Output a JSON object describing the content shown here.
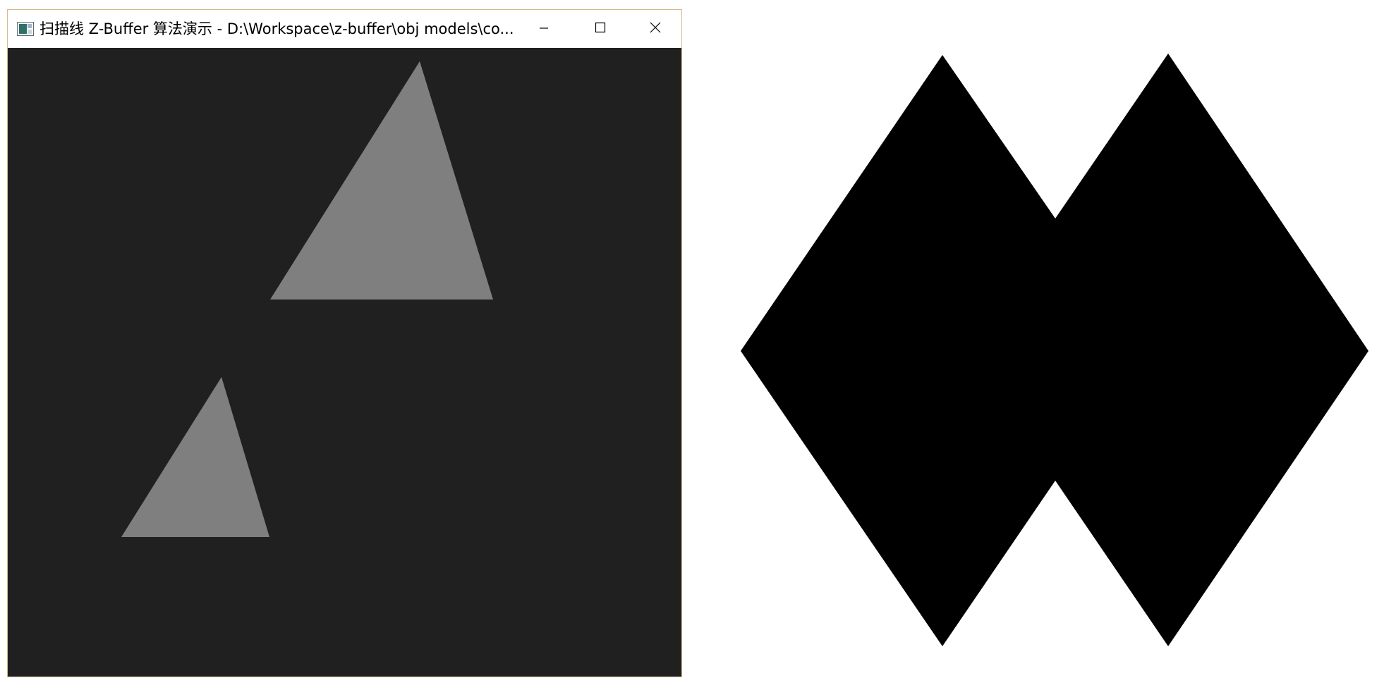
{
  "window": {
    "title": "扫描线 Z-Buffer 算法演示 - D:\\Workspace\\z-buffer\\obj models\\co...",
    "controls": {
      "minimize_icon": "minimize-icon",
      "maximize_icon": "maximize-icon",
      "close_icon": "close-icon"
    }
  },
  "colors": {
    "client_background": "#202020",
    "triangle_fill": "#7f7f7f",
    "right_shape_fill": "#000000",
    "window_border": "#d7b98c"
  }
}
